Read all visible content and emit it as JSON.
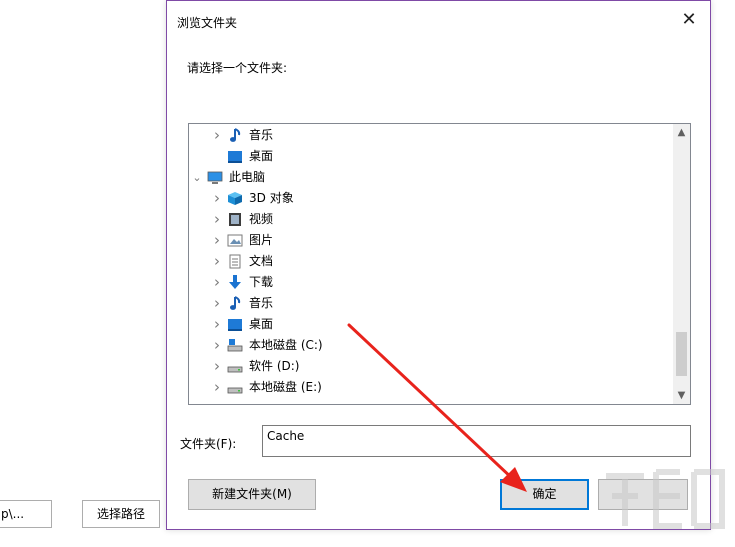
{
  "background": {
    "path_field_text": "p\\...",
    "select_path_button": "选择路径"
  },
  "dialog": {
    "title": "浏览文件夹",
    "close_glyph": "✕",
    "prompt": "请选择一个文件夹:",
    "tree_items": [
      {
        "label": "音乐",
        "icon": "music-icon",
        "expandable": true,
        "expanded": false,
        "level": 1
      },
      {
        "label": "桌面",
        "icon": "desktop-icon",
        "expandable": false,
        "expanded": false,
        "level": 1
      },
      {
        "label": "此电脑",
        "icon": "computer-icon",
        "expandable": true,
        "expanded": true,
        "level": 0
      },
      {
        "label": "3D 对象",
        "icon": "3d-objects-icon",
        "expandable": true,
        "expanded": false,
        "level": 1
      },
      {
        "label": "视频",
        "icon": "video-icon",
        "expandable": true,
        "expanded": false,
        "level": 1
      },
      {
        "label": "图片",
        "icon": "pictures-icon",
        "expandable": true,
        "expanded": false,
        "level": 1
      },
      {
        "label": "文档",
        "icon": "documents-icon",
        "expandable": true,
        "expanded": false,
        "level": 1
      },
      {
        "label": "下载",
        "icon": "download-icon",
        "expandable": true,
        "expanded": false,
        "level": 1
      },
      {
        "label": "音乐",
        "icon": "music-icon",
        "expandable": true,
        "expanded": false,
        "level": 1
      },
      {
        "label": "桌面",
        "icon": "desktop-icon",
        "expandable": true,
        "expanded": false,
        "level": 1
      },
      {
        "label": "本地磁盘 (C:)",
        "icon": "system-drive-icon",
        "expandable": true,
        "expanded": false,
        "level": 1
      },
      {
        "label": "软件 (D:)",
        "icon": "drive-icon",
        "expandable": true,
        "expanded": false,
        "level": 1
      },
      {
        "label": "本地磁盘 (E:)",
        "icon": "drive-icon",
        "expandable": true,
        "expanded": false,
        "level": 1
      }
    ],
    "folder_label": "文件夹(F):",
    "folder_value": "Cache",
    "new_folder_button": "新建文件夹(M)",
    "ok_button": "确定",
    "cancel_button": ""
  },
  "colors": {
    "dialog_border": "#7f4aa6",
    "focus_blue": "#0078d7",
    "arrow_red": "#e8231c"
  }
}
